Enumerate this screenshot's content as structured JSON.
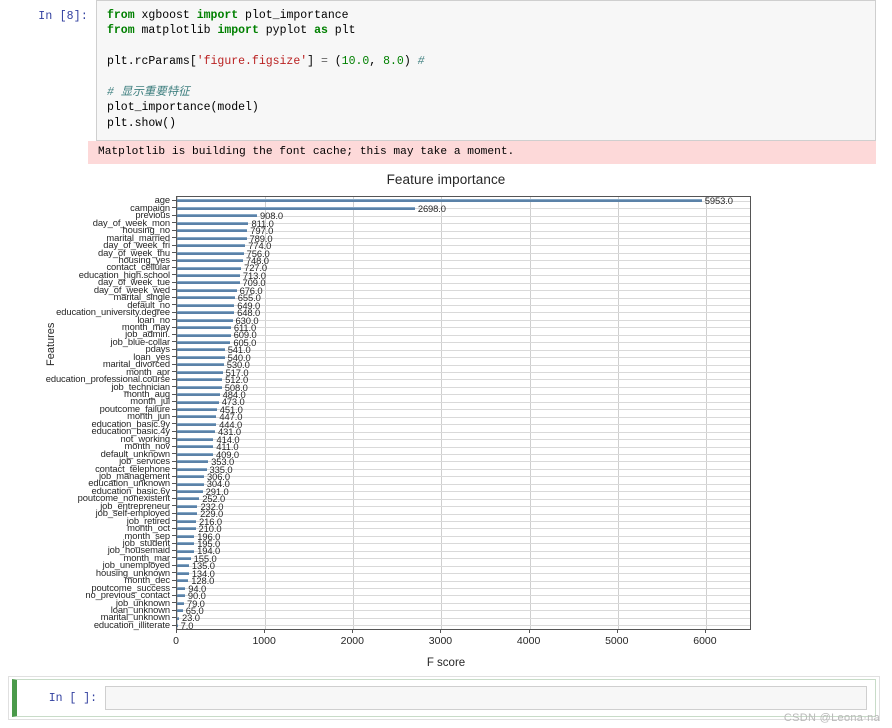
{
  "notebook": {
    "cell_in_prompt": "In [8]:",
    "empty_cell_prompt": "In [ ]:",
    "code_lines": [
      "from xgboost import plot_importance",
      "from matplotlib import pyplot as plt",
      "",
      "plt.rcParams['figure.figsize'] = (10.0, 8.0) #",
      "",
      "# 显示重要特征",
      "plot_importance(model)",
      "plt.show()"
    ],
    "stderr": "Matplotlib is building the font cache; this may take a moment.",
    "watermark": "CSDN @Leona·na"
  },
  "chart_data": {
    "type": "bar",
    "orientation": "horizontal",
    "title": "Feature importance",
    "xlabel": "F score",
    "ylabel": "Features",
    "xlim": [
      0,
      6500
    ],
    "xticks": [
      0,
      1000,
      2000,
      3000,
      4000,
      5000,
      6000
    ],
    "xtick_labels": [
      "0",
      "1000",
      "2000",
      "3000",
      "4000",
      "5000",
      "6000"
    ],
    "grid": true,
    "bar_color": "#5b82a8",
    "categories": [
      "age",
      "campaign",
      "previous",
      "day_of_week_mon",
      "housing_no",
      "marital_married",
      "day_of_week_fri",
      "day_of_week_thu",
      "housing_yes",
      "contact_cellular",
      "education_high.school",
      "day_of_week_tue",
      "day_of_week_wed",
      "marital_single",
      "default_no",
      "education_university.degree",
      "loan_no",
      "month_may",
      "job_admin.",
      "job_blue-collar",
      "pdays",
      "loan_yes",
      "marital_divorced",
      "month_apr",
      "education_professional.course",
      "job_technician",
      "month_aug",
      "month_jul",
      "poutcome_failure",
      "month_jun",
      "education_basic.9y",
      "education_basic.4y",
      "not_working",
      "month_nov",
      "default_unknown",
      "job_services",
      "contact_telephone",
      "job_management",
      "education_unknown",
      "education_basic.6y",
      "poutcome_nonexistent",
      "job_entrepreneur",
      "job_self-employed",
      "job_retired",
      "month_oct",
      "month_sep",
      "job_student",
      "job_housemaid",
      "month_mar",
      "job_unemployed",
      "housing_unknown",
      "month_dec",
      "poutcome_success",
      "no_previous_contact",
      "job_unknown",
      "loan_unknown",
      "marital_unknown",
      "education_illiterate"
    ],
    "values": [
      5953,
      2698,
      908,
      811,
      797,
      789,
      774,
      756,
      748,
      727,
      713,
      709,
      676,
      655,
      649,
      648,
      630,
      611,
      609,
      605,
      541,
      540,
      530,
      517,
      512,
      508,
      484,
      473,
      451,
      447,
      444,
      431,
      414,
      411,
      409,
      353,
      335,
      306,
      304,
      291,
      252,
      232,
      229,
      216,
      210,
      196,
      195,
      194,
      155,
      135,
      134,
      128,
      94,
      90,
      79,
      65,
      23,
      7
    ],
    "value_labels": [
      "5953.0",
      "2698.0",
      "908.0",
      "811.0",
      "797.0",
      "789.0",
      "774.0",
      "756.0",
      "748.0",
      "727.0",
      "713.0",
      "709.0",
      "676.0",
      "655.0",
      "649.0",
      "648.0",
      "630.0",
      "611.0",
      "609.0",
      "605.0",
      "541.0",
      "540.0",
      "530.0",
      "517.0",
      "512.0",
      "508.0",
      "484.0",
      "473.0",
      "451.0",
      "447.0",
      "444.0",
      "431.0",
      "414.0",
      "411.0",
      "409.0",
      "353.0",
      "335.0",
      "306.0",
      "304.0",
      "291.0",
      "252.0",
      "232.0",
      "229.0",
      "216.0",
      "210.0",
      "196.0",
      "195.0",
      "194.0",
      "155.0",
      "135.0",
      "134.0",
      "128.0",
      "94.0",
      "90.0",
      "79.0",
      "65.0",
      "23.0",
      "7.0"
    ]
  }
}
